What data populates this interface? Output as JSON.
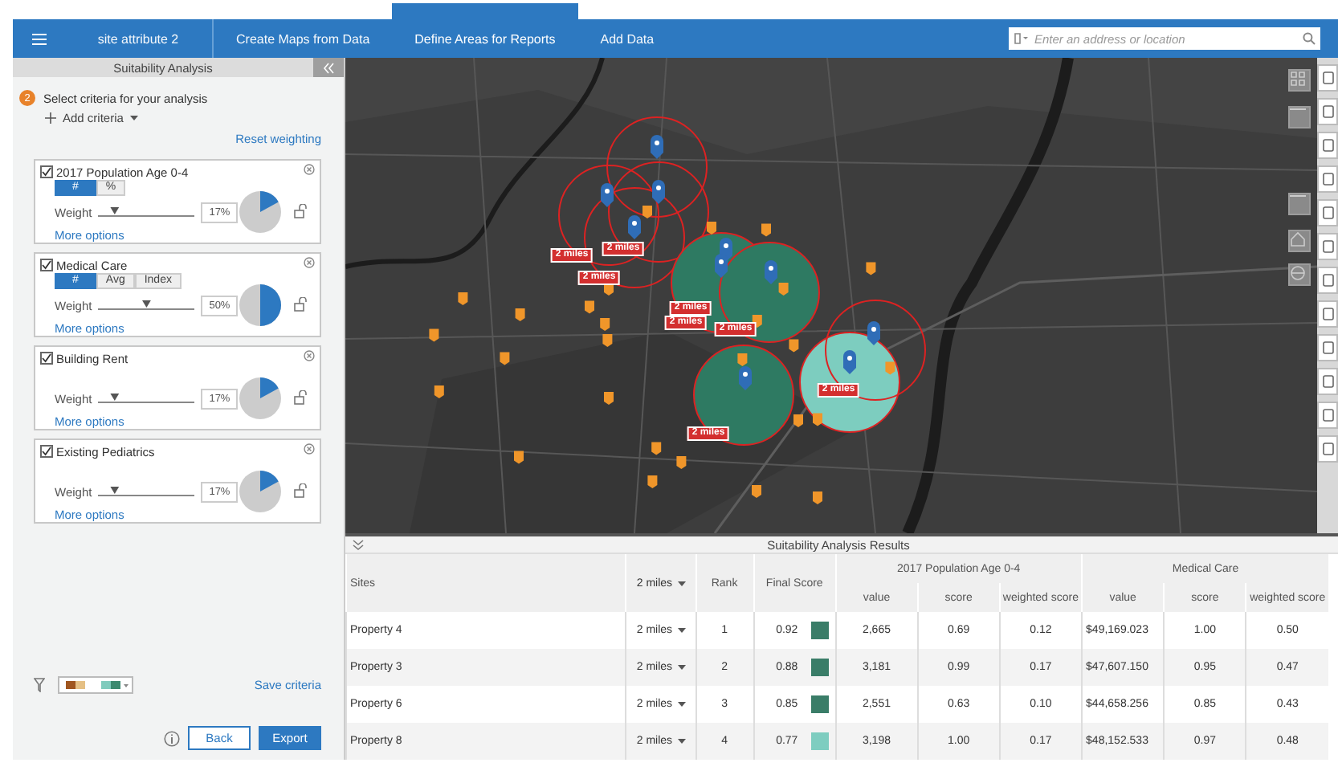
{
  "nav": {
    "tabs": [
      {
        "label": "site attribute 2",
        "selected": false
      },
      {
        "label": "Create Maps from Data",
        "selected": false
      },
      {
        "label": "Define Areas for Reports",
        "selected": true
      },
      {
        "label": "Add Data",
        "selected": false
      }
    ],
    "search": {
      "placeholder": "Enter an address or location"
    }
  },
  "panel": {
    "title": "Suitability Analysis",
    "step": {
      "number": "2",
      "text": "Select criteria for your analysis"
    },
    "add_criteria": "Add criteria",
    "reset": "Reset weighting",
    "criteria": [
      {
        "name": "2017 Population Age 0-4",
        "checked": true,
        "modes": [
          {
            "label": "#",
            "selected": true
          },
          {
            "label": "%",
            "selected": false
          }
        ],
        "weight_label": "Weight",
        "level": 0.17,
        "percent": "17%",
        "more": "More options"
      },
      {
        "name": "Medical Care",
        "checked": true,
        "modes": [
          {
            "label": "#",
            "selected": true
          },
          {
            "label": "Avg",
            "selected": false
          },
          {
            "label": "Index",
            "selected": false
          }
        ],
        "weight_label": "Weight",
        "level": 0.5,
        "percent": "50%",
        "more": "More options"
      },
      {
        "name": "Building Rent",
        "checked": true,
        "weight_label": "Weight",
        "level": 0.17,
        "percent": "17%",
        "more": "More options"
      },
      {
        "name": "Existing Pediatrics",
        "checked": true,
        "weight_label": "Weight",
        "level": 0.17,
        "percent": "17%",
        "more": "More options"
      }
    ],
    "save": "Save criteria",
    "buttons": [
      {
        "label": "Back",
        "kind": "secondary"
      },
      {
        "label": "Export",
        "kind": "primary"
      }
    ]
  },
  "map": {
    "kind": "picture",
    "buffers": [
      {
        "kind": "outline"
      },
      {
        "kind": "outline"
      },
      {
        "kind": "outline"
      },
      {
        "kind": "outline"
      },
      {
        "kind": "dark"
      },
      {
        "kind": "dark"
      },
      {
        "kind": "dark"
      },
      {
        "kind": "light"
      },
      {
        "kind": "outline"
      }
    ],
    "labels": [
      "2 miles",
      "2 miles",
      "2 miles",
      "2 miles",
      "2 miles",
      "2 miles",
      "2 miles",
      "2 miles"
    ]
  },
  "results": {
    "title": "Suitability Analysis Results",
    "columns": {
      "site": "Sites",
      "distance": "2 miles",
      "rank": "Rank",
      "final": "Final Score",
      "groups": [
        {
          "title": "2017 Population Age 0-4",
          "sub": [
            "value",
            "score",
            "weighted score"
          ]
        },
        {
          "title": "Medical Care",
          "sub": [
            "value",
            "score",
            "weighted score"
          ]
        }
      ]
    },
    "rows": [
      {
        "site": "Property 4",
        "distance": "2 miles",
        "rank": "1",
        "final": "0.92",
        "color": "#3a7d68",
        "values": [
          "2,665",
          "0.69",
          "0.12",
          "$49,169.023",
          "1.00",
          "0.50"
        ]
      },
      {
        "site": "Property 3",
        "distance": "2 miles",
        "rank": "2",
        "final": "0.88",
        "color": "#3a7d68",
        "values": [
          "3,181",
          "0.99",
          "0.17",
          "$47,607.150",
          "0.95",
          "0.47"
        ]
      },
      {
        "site": "Property 6",
        "distance": "2 miles",
        "rank": "3",
        "final": "0.85",
        "color": "#3a7d68",
        "values": [
          "2,551",
          "0.63",
          "0.10",
          "$44,658.256",
          "0.85",
          "0.43"
        ]
      },
      {
        "site": "Property 8",
        "distance": "2 miles",
        "rank": "4",
        "final": "0.77",
        "color": "#7ecdc0",
        "values": [
          "3,198",
          "1.00",
          "0.17",
          "$48,152.533",
          "0.97",
          "0.48"
        ]
      }
    ]
  }
}
